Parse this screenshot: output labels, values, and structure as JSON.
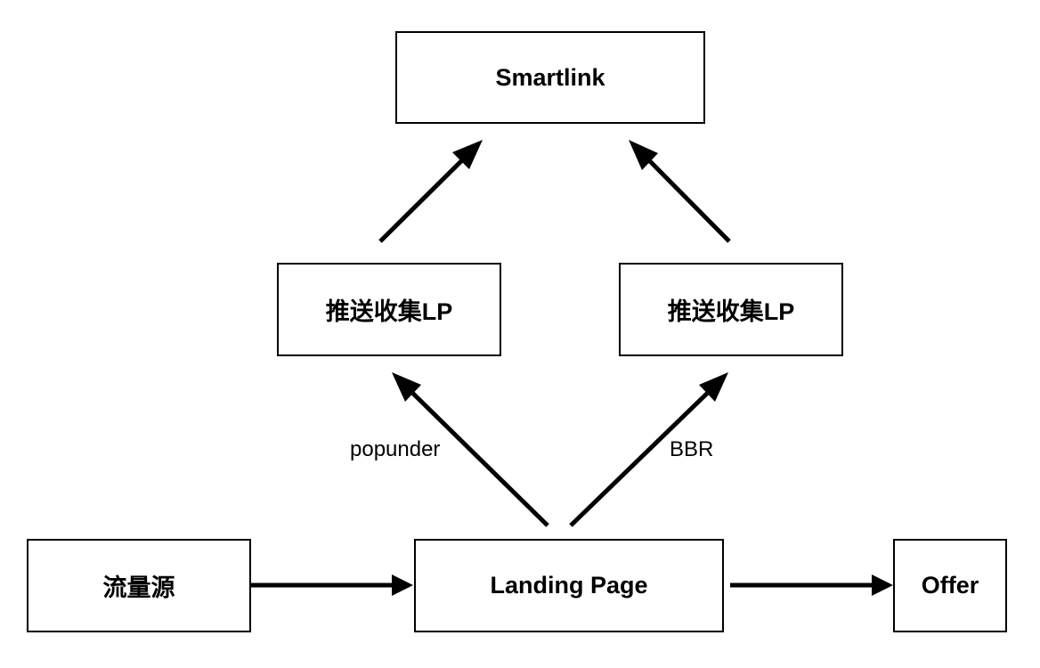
{
  "diagram": {
    "nodes": {
      "smartlink": "Smartlink",
      "push_lp_left": "推送收集LP",
      "push_lp_right": "推送收集LP",
      "traffic_source": "流量源",
      "landing_page": "Landing Page",
      "offer": "Offer"
    },
    "edge_labels": {
      "popunder": "popunder",
      "bbr": "BBR"
    },
    "edges": [
      {
        "from": "traffic_source",
        "to": "landing_page"
      },
      {
        "from": "landing_page",
        "to": "offer"
      },
      {
        "from": "landing_page",
        "to": "push_lp_left",
        "label": "popunder"
      },
      {
        "from": "landing_page",
        "to": "push_lp_right",
        "label": "BBR"
      },
      {
        "from": "push_lp_left",
        "to": "smartlink"
      },
      {
        "from": "push_lp_right",
        "to": "smartlink"
      }
    ],
    "colors": {
      "stroke": "#000000",
      "background": "#ffffff"
    }
  }
}
